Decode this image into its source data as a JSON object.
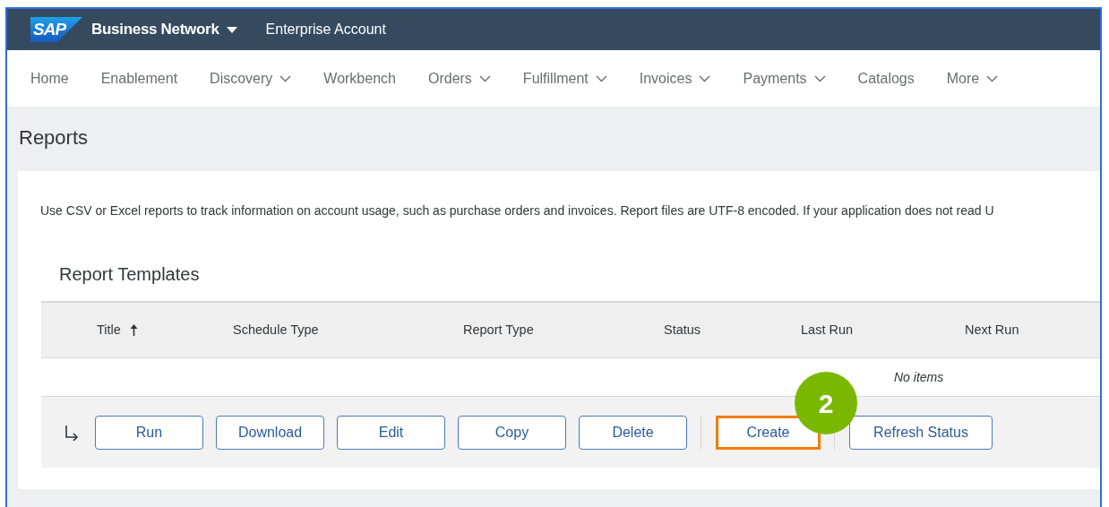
{
  "header": {
    "logo_text": "SAP",
    "product": "Business Network",
    "account": "Enterprise Account"
  },
  "nav": [
    {
      "label": "Home",
      "dropdown": false
    },
    {
      "label": "Enablement",
      "dropdown": false
    },
    {
      "label": "Discovery",
      "dropdown": true
    },
    {
      "label": "Workbench",
      "dropdown": false
    },
    {
      "label": "Orders",
      "dropdown": true
    },
    {
      "label": "Fulfillment",
      "dropdown": true
    },
    {
      "label": "Invoices",
      "dropdown": true
    },
    {
      "label": "Payments",
      "dropdown": true
    },
    {
      "label": "Catalogs",
      "dropdown": false
    },
    {
      "label": "More",
      "dropdown": true
    }
  ],
  "page_title": "Reports",
  "description": "Use CSV or Excel reports to track information on account usage, such as purchase orders and invoices. Report files are UTF-8 encoded. If your application does not read U",
  "section_title": "Report Templates",
  "table": {
    "columns": [
      {
        "label": "Title",
        "sorted": true
      },
      {
        "label": "Schedule Type",
        "sorted": false
      },
      {
        "label": "Report Type",
        "sorted": false
      },
      {
        "label": "Status",
        "sorted": false
      },
      {
        "label": "Last Run",
        "sorted": false
      },
      {
        "label": "Next Run",
        "sorted": false
      }
    ],
    "empty_text": "No items"
  },
  "actions": [
    {
      "label": "Run",
      "separator_before": false,
      "highlighted": false
    },
    {
      "label": "Download",
      "separator_before": false,
      "highlighted": false
    },
    {
      "label": "Edit",
      "separator_before": false,
      "highlighted": false
    },
    {
      "label": "Copy",
      "separator_before": false,
      "highlighted": false
    },
    {
      "label": "Delete",
      "separator_before": false,
      "highlighted": false
    },
    {
      "label": "Create",
      "separator_before": true,
      "highlighted": true
    },
    {
      "label": "Refresh Status",
      "separator_before": true,
      "highlighted": false
    }
  ],
  "callout": {
    "label": "2"
  }
}
